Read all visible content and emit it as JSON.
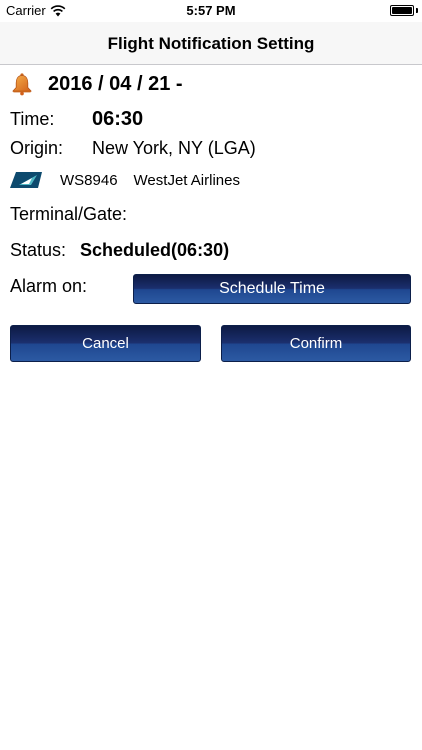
{
  "status_bar": {
    "carrier": "Carrier",
    "time": "5:57 PM",
    "icons": [
      "wifi-icon",
      "battery-icon"
    ]
  },
  "nav": {
    "title": "Flight Notification Setting"
  },
  "flight": {
    "date": "2016 / 04 / 21 -",
    "time_label": "Time:",
    "time_value": "06:30",
    "origin_label": "Origin:",
    "origin_value": "New York, NY (LGA)",
    "flight_number": "WS8946",
    "airline": "WestJet Airlines",
    "terminal_label": "Terminal/Gate:",
    "status_label": "Status:",
    "status_value": "Scheduled(06:30)",
    "alarm_label": "Alarm on:"
  },
  "buttons": {
    "schedule": "Schedule Time",
    "cancel": "Cancel",
    "confirm": "Confirm"
  },
  "colors": {
    "button_dark": "#0d1a44",
    "button_light": "#2c5aa3",
    "bell": "#e07a1f",
    "airline_logo": "#0d4a6e"
  }
}
